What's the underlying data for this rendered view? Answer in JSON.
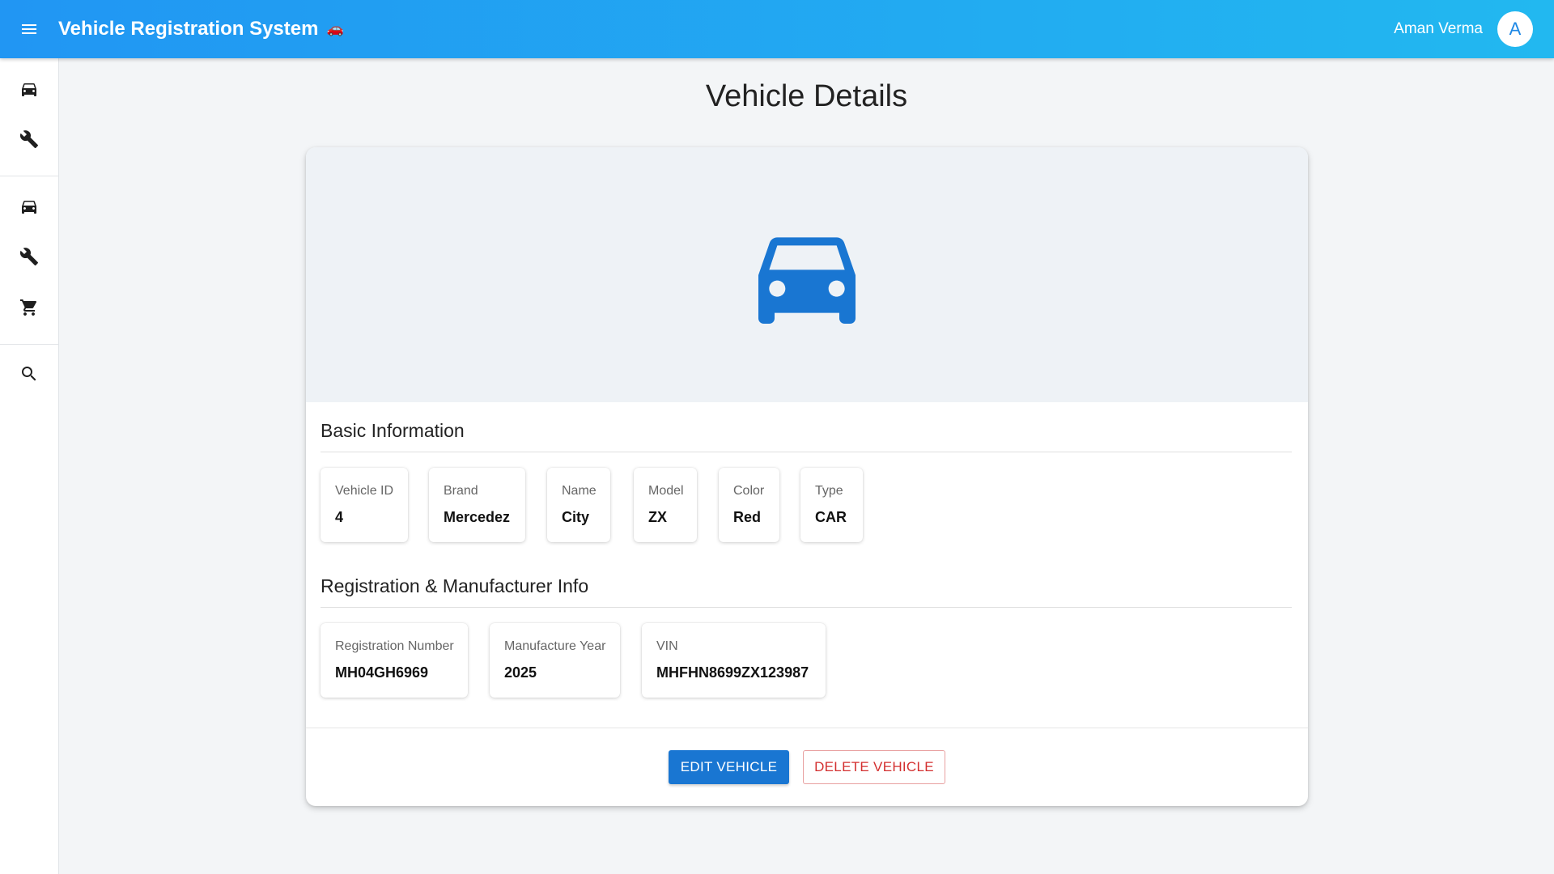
{
  "app": {
    "title": "Vehicle Registration System",
    "title_emoji": "🚗",
    "user_name": "Aman Verma",
    "avatar_initial": "A"
  },
  "sidebar": {
    "items": [
      {
        "icon": "car-icon"
      },
      {
        "icon": "wrench-icon"
      },
      {
        "icon": "car-icon"
      },
      {
        "icon": "wrench-icon"
      },
      {
        "icon": "cart-icon"
      },
      {
        "icon": "search-icon"
      }
    ]
  },
  "page": {
    "title": "Vehicle Details"
  },
  "basic": {
    "title": "Basic Information",
    "fields": [
      {
        "label": "Vehicle ID",
        "value": "4"
      },
      {
        "label": "Brand",
        "value": "Mercedez"
      },
      {
        "label": "Name",
        "value": "City"
      },
      {
        "label": "Model",
        "value": "ZX"
      },
      {
        "label": "Color",
        "value": "Red"
      },
      {
        "label": "Type",
        "value": "CAR"
      }
    ]
  },
  "registration": {
    "title": "Registration & Manufacturer Info",
    "fields": [
      {
        "label": "Registration Number",
        "value": "MH04GH6969"
      },
      {
        "label": "Manufacture Year",
        "value": "2025"
      },
      {
        "label": "VIN",
        "value": "MHFHN8699ZX123987"
      }
    ]
  },
  "actions": {
    "edit_label": "EDIT VEHICLE",
    "delete_label": "DELETE VEHICLE"
  },
  "colors": {
    "appbar_start": "#2196f3",
    "appbar_end": "#22b8f0",
    "hero_icon": "#1976d2",
    "primary_button": "#1976d2",
    "danger": "#d32f2f"
  }
}
